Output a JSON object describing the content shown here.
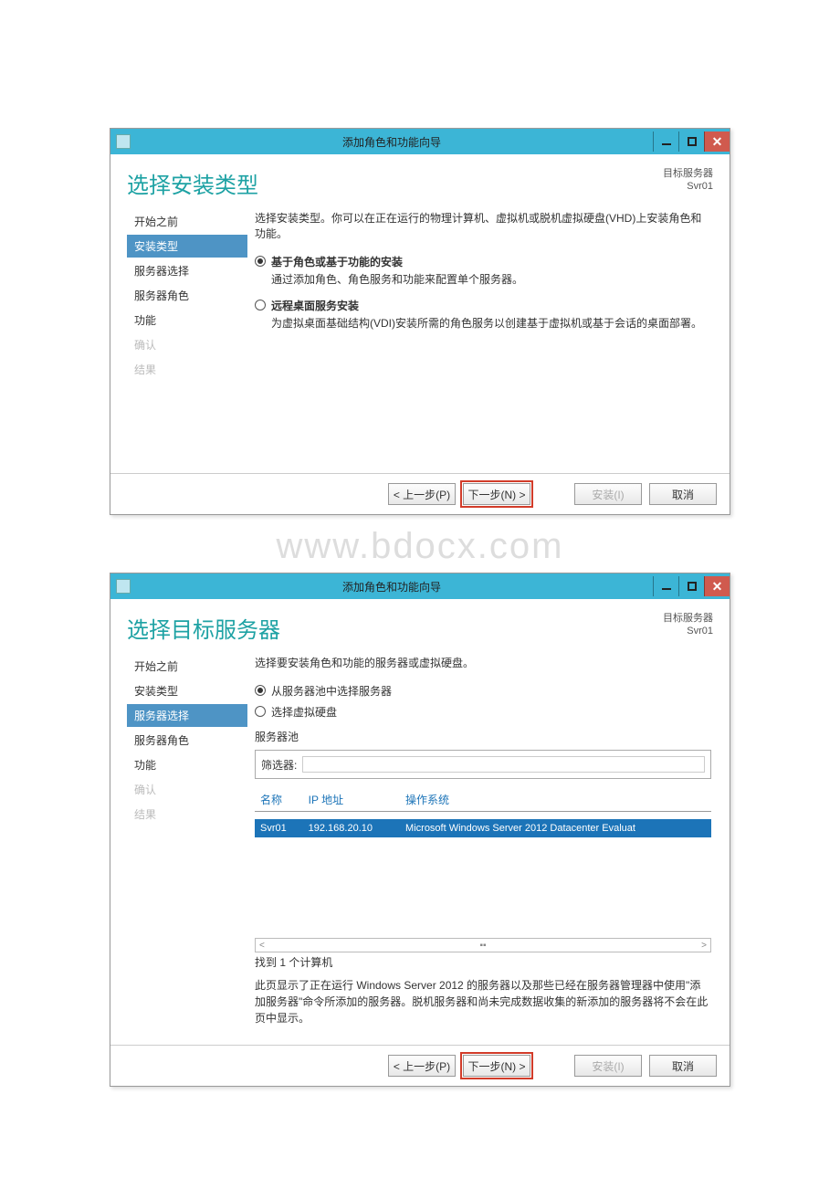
{
  "watermark": "www.bdocx.com",
  "window1": {
    "title": "添加角色和功能向导",
    "page_title": "选择安装类型",
    "target_label": "目标服务器",
    "target_value": "Svr01",
    "sidebar": [
      {
        "label": "开始之前",
        "state": "normal"
      },
      {
        "label": "安装类型",
        "state": "active"
      },
      {
        "label": "服务器选择",
        "state": "normal"
      },
      {
        "label": "服务器角色",
        "state": "normal"
      },
      {
        "label": "功能",
        "state": "normal"
      },
      {
        "label": "确认",
        "state": "disabled"
      },
      {
        "label": "结果",
        "state": "disabled"
      }
    ],
    "desc": "选择安装类型。你可以在正在运行的物理计算机、虚拟机或脱机虚拟硬盘(VHD)上安装角色和功能。",
    "opt1_label": "基于角色或基于功能的安装",
    "opt1_desc": "通过添加角色、角色服务和功能来配置单个服务器。",
    "opt2_label": "远程桌面服务安装",
    "opt2_desc": "为虚拟桌面基础结构(VDI)安装所需的角色服务以创建基于虚拟机或基于会话的桌面部署。",
    "buttons": {
      "prev": "< 上一步(P)",
      "next": "下一步(N) >",
      "install": "安装(I)",
      "cancel": "取消"
    }
  },
  "window2": {
    "title": "添加角色和功能向导",
    "page_title": "选择目标服务器",
    "target_label": "目标服务器",
    "target_value": "Svr01",
    "sidebar": [
      {
        "label": "开始之前",
        "state": "normal"
      },
      {
        "label": "安装类型",
        "state": "normal"
      },
      {
        "label": "服务器选择",
        "state": "active"
      },
      {
        "label": "服务器角色",
        "state": "normal"
      },
      {
        "label": "功能",
        "state": "normal"
      },
      {
        "label": "确认",
        "state": "disabled"
      },
      {
        "label": "结果",
        "state": "disabled"
      }
    ],
    "desc": "选择要安装角色和功能的服务器或虚拟硬盘。",
    "opt1_label": "从服务器池中选择服务器",
    "opt2_label": "选择虚拟硬盘",
    "pool_label": "服务器池",
    "filter_label": "筛选器:",
    "columns": {
      "name": "名称",
      "ip": "IP 地址",
      "os": "操作系统"
    },
    "row": {
      "name": "Svr01",
      "ip": "192.168.20.10",
      "os": "Microsoft Windows Server 2012 Datacenter Evaluat"
    },
    "found": "找到 1 个计算机",
    "note": "此页显示了正在运行 Windows Server 2012 的服务器以及那些已经在服务器管理器中使用\"添加服务器\"命令所添加的服务器。脱机服务器和尚未完成数据收集的新添加的服务器将不会在此页中显示。",
    "buttons": {
      "prev": "< 上一步(P)",
      "next": "下一步(N) >",
      "install": "安装(I)",
      "cancel": "取消"
    }
  }
}
